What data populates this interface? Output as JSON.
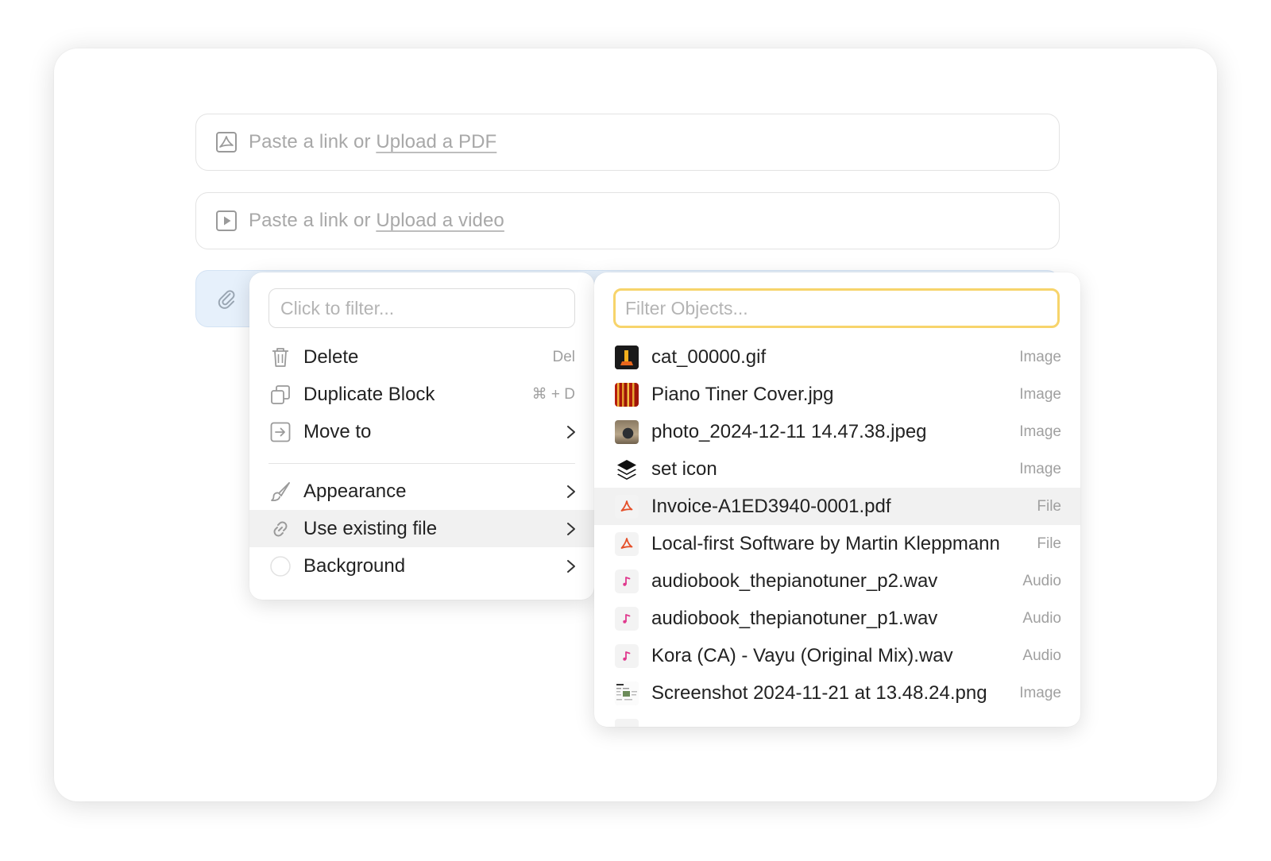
{
  "blocks": {
    "pdf": {
      "prefix": "Paste a link or ",
      "link": "Upload a PDF"
    },
    "video": {
      "prefix": "Paste a link or ",
      "link": "Upload a video"
    }
  },
  "context_menu": {
    "filter_placeholder": "Click to filter...",
    "items": [
      {
        "label": "Delete",
        "shortcut": "Del",
        "icon": "trash-icon"
      },
      {
        "label": "Duplicate Block",
        "shortcut": "⌘ + D",
        "icon": "duplicate-icon"
      },
      {
        "label": "Move to",
        "icon": "move-to-icon"
      },
      {
        "label": "Appearance",
        "icon": "paintbrush-icon"
      },
      {
        "label": "Use existing file",
        "icon": "link-icon"
      },
      {
        "label": "Background",
        "icon": "circle-icon"
      }
    ]
  },
  "objects_menu": {
    "filter_placeholder": "Filter Objects...",
    "accent": "#f7d46b",
    "items": [
      {
        "name": "cat_00000.gif",
        "type": "Image"
      },
      {
        "name": "Piano Tiner Cover.jpg",
        "type": "Image"
      },
      {
        "name": "photo_2024-12-11 14.47.38.jpeg",
        "type": "Image"
      },
      {
        "name": "set icon",
        "type": "Image"
      },
      {
        "name": "Invoice-A1ED3940-0001.pdf",
        "type": "File"
      },
      {
        "name": "Local-first Software by Martin Kleppmann",
        "type": "File"
      },
      {
        "name": "audiobook_thepianotuner_p2.wav",
        "type": "Audio"
      },
      {
        "name": "audiobook_thepianotuner_p1.wav",
        "type": "Audio"
      },
      {
        "name": "Kora (CA) - Vayu (Original Mix).wav",
        "type": "Audio"
      },
      {
        "name": "Screenshot 2024-11-21 at 13.48.24.png",
        "type": "Image"
      }
    ]
  }
}
